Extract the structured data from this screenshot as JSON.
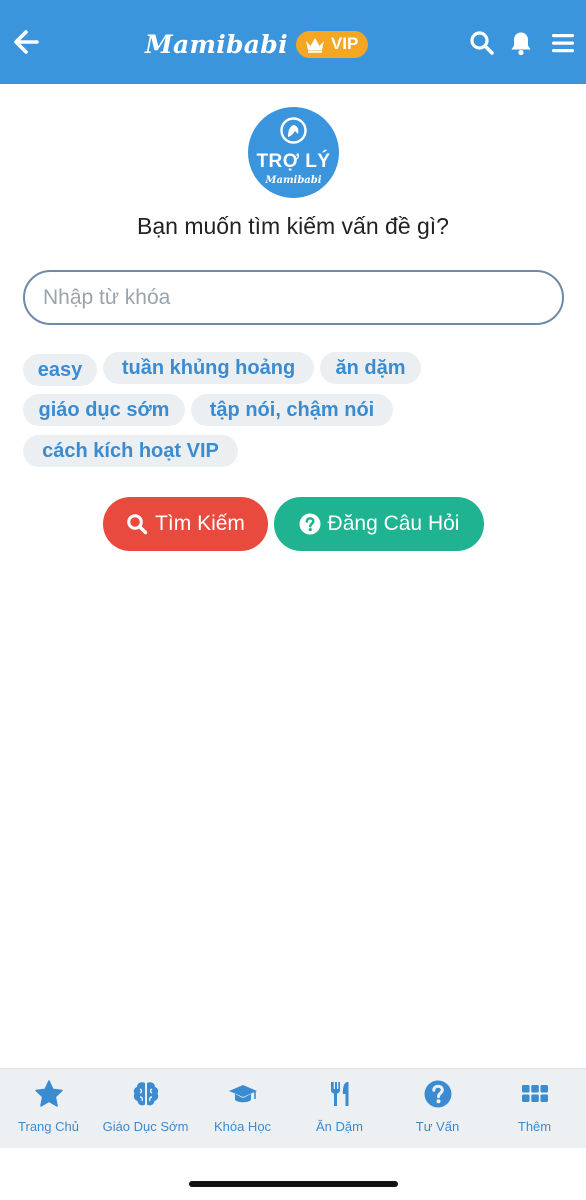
{
  "header": {
    "brand": "Mamibabi",
    "vip_label": "VIP"
  },
  "logo": {
    "title": "TRỢ LÝ",
    "subtitle": "Mamibabi"
  },
  "main": {
    "question": "Bạn muốn tìm kiếm vấn đề gì?",
    "search_placeholder": "Nhập từ khóa",
    "search_value": "",
    "tags": [
      "easy",
      "tuần khủng hoảng",
      "ăn dặm",
      "giáo dục sớm",
      "tập nói, chậm nói",
      "cách kích hoạt VIP"
    ],
    "search_button": "Tìm Kiếm",
    "ask_button": "Đăng Câu Hỏi"
  },
  "bottom_nav": [
    {
      "label": "Trang Chủ",
      "icon": "star-icon"
    },
    {
      "label": "Giáo Dục Sớm",
      "icon": "brain-icon"
    },
    {
      "label": "Khóa Học",
      "icon": "graduation-cap-icon"
    },
    {
      "label": "Ăn Dặm",
      "icon": "utensils-icon"
    },
    {
      "label": "Tư Vấn",
      "icon": "question-circle-icon"
    },
    {
      "label": "Thêm",
      "icon": "grid-icon"
    }
  ],
  "colors": {
    "primary": "#3a95dc",
    "vip": "#f5a623",
    "search_button": "#e84a3d",
    "ask_button": "#1fb391",
    "tag_text": "#3a8bd0",
    "tag_bg": "#eceff2"
  }
}
